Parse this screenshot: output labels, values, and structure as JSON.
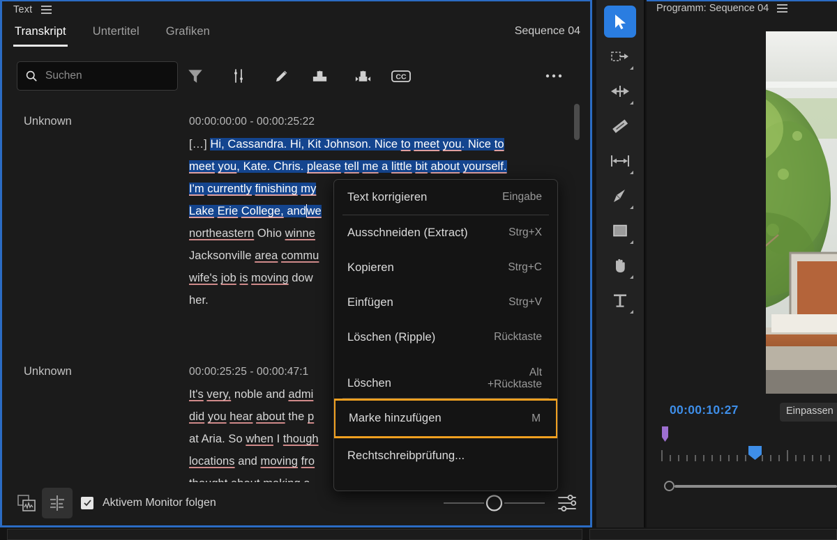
{
  "text_panel": {
    "title": "Text",
    "menu_icon": "hamburger-icon",
    "tabs": [
      {
        "label": "Transkript",
        "active": true
      },
      {
        "label": "Untertitel",
        "active": false
      },
      {
        "label": "Grafiken",
        "active": false
      }
    ],
    "sequence_label": "Sequence 04",
    "search": {
      "placeholder": "Suchen",
      "icon": "search-icon"
    },
    "toolbar_icons": [
      "filter-icon",
      "sort-icon",
      "pencil-edit-icon",
      "merge-clips-icon",
      "split-clips-icon",
      "closed-captions-icon",
      "more-options-icon"
    ],
    "bottom": {
      "clip-view-icon": "clip-view-icon",
      "transcript-view-icon": "transcript-view-icon",
      "follow_label": "Aktivem Monitor folgen",
      "follow_checked": true,
      "settings_icon": "settings-sliders-icon"
    }
  },
  "transcript": {
    "blocks": [
      {
        "speaker": "Unknown",
        "timecode": "00:00:00:00 - 00:00:25:22",
        "lines": [
          "[…] Hi, Cassandra. Hi, Kit Johnson. Nice to meet you. Nice to",
          "meet you, Kate. Chris. please tell me a little bit about yourself.",
          "I'm currently finishing my",
          "Lake Erie College, and we",
          "northeastern Ohio winne",
          "Jacksonville area commu",
          "wife's job is moving dow",
          "her."
        ]
      },
      {
        "speaker": "Unknown",
        "timecode": "00:00:25:25 - 00:00:47:1",
        "lines": [
          "It's very, noble and admi",
          "did you hear about the p",
          "at Aria. So when I though",
          "locations and moving fro",
          "thought about making a"
        ]
      }
    ]
  },
  "context_menu": {
    "items": [
      {
        "label": "Text korrigieren",
        "shortcut": "Eingabe",
        "separator_after": true,
        "highlighted": false
      },
      {
        "label": "Ausschneiden (Extract)",
        "shortcut": "Strg+X",
        "separator_after": false,
        "highlighted": false
      },
      {
        "label": "Kopieren",
        "shortcut": "Strg+C",
        "separator_after": false,
        "highlighted": false
      },
      {
        "label": "Einfügen",
        "shortcut": "Strg+V",
        "separator_after": false,
        "highlighted": false
      },
      {
        "label": "Löschen (Ripple)",
        "shortcut": "Rücktaste",
        "separator_after": false,
        "highlighted": false
      },
      {
        "label": "Löschen",
        "shortcut": "Alt\n+Rücktaste",
        "separator_after": true,
        "highlighted": false
      },
      {
        "label": "Marke hinzufügen",
        "shortcut": "M",
        "separator_after": false,
        "highlighted": true
      },
      {
        "label": "Rechtschreibprüfung...",
        "shortcut": "",
        "separator_after": false,
        "highlighted": false
      }
    ],
    "highlight_color": "#f0a020"
  },
  "tools": [
    {
      "name": "selection-tool",
      "selected": true
    },
    {
      "name": "track-select-forward-tool",
      "selected": false
    },
    {
      "name": "ripple-edit-tool",
      "selected": false
    },
    {
      "name": "razor-tool",
      "selected": false
    },
    {
      "name": "slip-tool",
      "selected": false
    },
    {
      "name": "pen-tool",
      "selected": false
    },
    {
      "name": "rectangle-tool",
      "selected": false
    },
    {
      "name": "hand-tool",
      "selected": false
    },
    {
      "name": "type-tool",
      "selected": false
    }
  ],
  "program_monitor": {
    "title": "Programm: Sequence 04",
    "menu_icon": "hamburger-icon",
    "timecode": "00:00:10:27",
    "fit_button": "Einpassen",
    "timecode_color": "#3e8ee8"
  }
}
